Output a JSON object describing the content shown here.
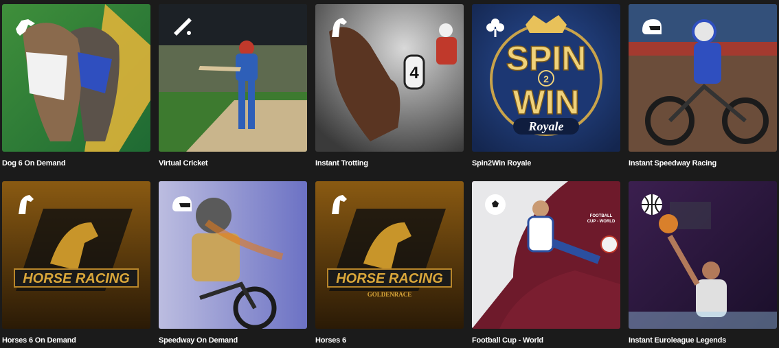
{
  "games": [
    {
      "title": "Dog 6 On Demand",
      "icon": "greyhound-icon"
    },
    {
      "title": "Virtual Cricket",
      "icon": "cricket-bat-icon"
    },
    {
      "title": "Instant Trotting",
      "icon": "horse-head-icon"
    },
    {
      "title": "Spin2Win Royale",
      "icon": "clover-icon",
      "logo_text": [
        "SPIN",
        "2",
        "WIN",
        "Royale"
      ]
    },
    {
      "title": "Instant Speedway Racing",
      "icon": "helmet-icon"
    },
    {
      "title": "Horses 6 On Demand",
      "icon": "horse-head-icon",
      "logo_text": [
        "HORSE RACING"
      ]
    },
    {
      "title": "Speedway On Demand",
      "icon": "helmet-icon"
    },
    {
      "title": "Horses 6",
      "icon": "horse-head-icon",
      "logo_text": [
        "HORSE RACING",
        "GOLDENRACE"
      ]
    },
    {
      "title": "Football Cup - World",
      "icon": "soccer-ball-icon",
      "logo_text": [
        "FOOTBALL",
        "CUP - WORLD"
      ]
    },
    {
      "title": "Instant Euroleague Legends",
      "icon": "basketball-icon"
    }
  ],
  "colors": {
    "background": "#1b1b1b",
    "label": "#ffffff"
  }
}
